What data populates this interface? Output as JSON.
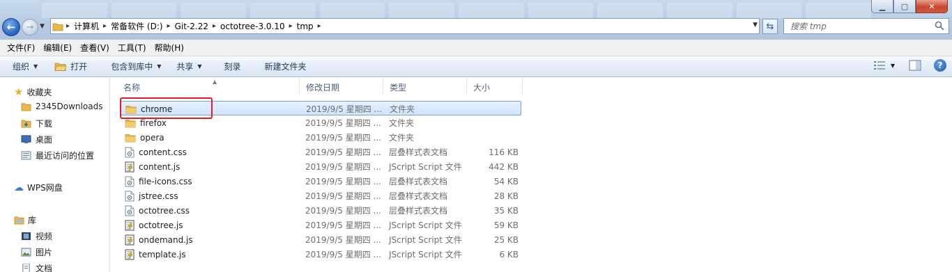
{
  "window": {
    "minimize": "▁",
    "maximize": "▢",
    "close": "✕"
  },
  "address": {
    "crumbs": [
      "计算机",
      "常备软件 (D:)",
      "Git-2.22",
      "octotree-3.0.10",
      "tmp"
    ],
    "search_placeholder": "搜索 tmp"
  },
  "menu": [
    "文件(F)",
    "编辑(E)",
    "查看(V)",
    "工具(T)",
    "帮助(H)"
  ],
  "toolbar": {
    "organize": "组织",
    "open": "打开",
    "include_in_library": "包含到库中",
    "share": "共享",
    "burn": "刻录",
    "new_folder": "新建文件夹",
    "help": "?"
  },
  "nav": {
    "favorites": {
      "label": "收藏夹",
      "items": [
        "2345Downloads",
        "下载",
        "桌面",
        "最近访问的位置"
      ]
    },
    "wps": "WPS网盘",
    "libraries": {
      "label": "库",
      "items": [
        "视频",
        "图片",
        "文档"
      ]
    }
  },
  "columns": {
    "name": "名称",
    "date": "修改日期",
    "type": "类型",
    "size": "大小"
  },
  "files": [
    {
      "name": "chrome",
      "date": "2019/9/5 星期四 ...",
      "type": "文件夹",
      "size": "",
      "icon": "folder-icon",
      "selected": true
    },
    {
      "name": "firefox",
      "date": "2019/9/5 星期四 ...",
      "type": "文件夹",
      "size": "",
      "icon": "folder-icon"
    },
    {
      "name": "opera",
      "date": "2019/9/5 星期四 ...",
      "type": "文件夹",
      "size": "",
      "icon": "folder-icon"
    },
    {
      "name": "content.css",
      "date": "2019/9/5 星期四 ...",
      "type": "层叠样式表文档",
      "size": "116 KB",
      "icon": "css-file-icon"
    },
    {
      "name": "content.js",
      "date": "2019/9/5 星期四 ...",
      "type": "JScript Script 文件",
      "size": "442 KB",
      "icon": "js-file-icon"
    },
    {
      "name": "file-icons.css",
      "date": "2019/9/5 星期四 ...",
      "type": "层叠样式表文档",
      "size": "54 KB",
      "icon": "css-file-icon"
    },
    {
      "name": "jstree.css",
      "date": "2019/9/5 星期四 ...",
      "type": "层叠样式表文档",
      "size": "28 KB",
      "icon": "css-file-icon"
    },
    {
      "name": "octotree.css",
      "date": "2019/9/5 星期四 ...",
      "type": "层叠样式表文档",
      "size": "35 KB",
      "icon": "css-file-icon"
    },
    {
      "name": "octotree.js",
      "date": "2019/9/5 星期四 ...",
      "type": "JScript Script 文件",
      "size": "59 KB",
      "icon": "js-file-icon"
    },
    {
      "name": "ondemand.js",
      "date": "2019/9/5 星期四 ...",
      "type": "JScript Script 文件",
      "size": "25 KB",
      "icon": "js-file-icon"
    },
    {
      "name": "template.js",
      "date": "2019/9/5 星期四 ...",
      "type": "JScript Script 文件",
      "size": "6 KB",
      "icon": "js-file-icon"
    }
  ],
  "colors": {
    "selection_border": "#7da2ce",
    "annotation_red": "#e02020",
    "folder_yellow": "#e8b84a"
  }
}
